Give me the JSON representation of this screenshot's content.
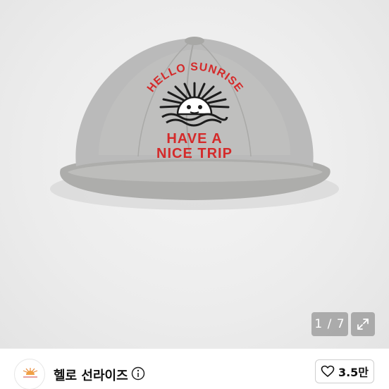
{
  "product_image": {
    "cap_text_top": "HELLO SUNRISE",
    "cap_text_line1": "HAVE A",
    "cap_text_line2": "NICE TRIP",
    "counter": "1 / 7",
    "expand_icon": "expand-icon",
    "colors": {
      "cap": "#b9b9b7",
      "embroidery": "#d42a2a",
      "background": "#eeeeee"
    }
  },
  "shop": {
    "name": "헬로 선라이즈",
    "logo_icon": "sunrise-logo-icon",
    "info_icon": "info-icon"
  },
  "like": {
    "icon": "heart-icon",
    "count": "3.5만"
  }
}
